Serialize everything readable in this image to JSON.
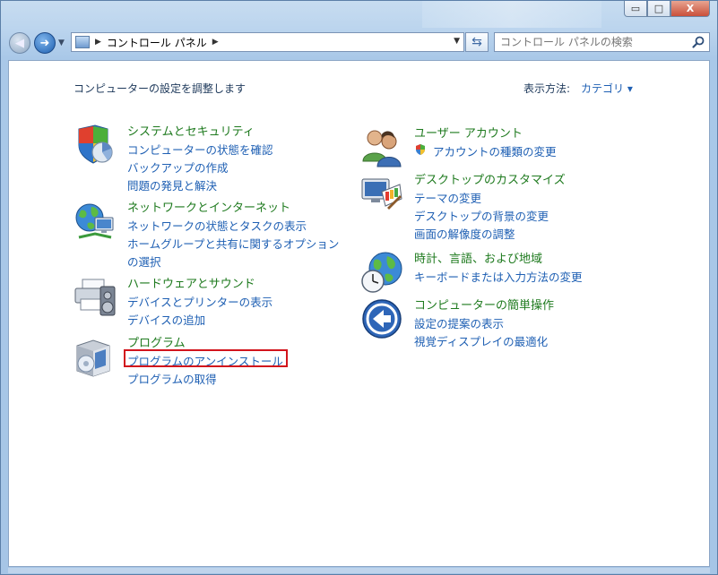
{
  "window": {
    "minimize_glyph": "▭",
    "maximize_glyph": "□",
    "close_glyph": "X"
  },
  "nav": {
    "back_glyph": "◀",
    "forward_glyph": "➜",
    "recent_glyph": "▼",
    "address_path": [
      "コントロール パネル"
    ],
    "address_sep": "▶",
    "address_dropdown": "▼",
    "refresh_glyph": "⇆",
    "search_placeholder": "コントロール パネルの検索"
  },
  "content": {
    "header": "コンピューターの設定を調整します",
    "view_label": "表示方法:",
    "view_value": "カテゴリ ▾"
  },
  "categories_left": [
    {
      "title": "システムとセキュリティ",
      "icon": "shield-chart-icon",
      "links": [
        "コンピューターの状態を確認",
        "バックアップの作成",
        "問題の発見と解決"
      ]
    },
    {
      "title": "ネットワークとインターネット",
      "icon": "network-globe-icon",
      "links": [
        "ネットワークの状態とタスクの表示",
        "ホームグループと共有に関するオプションの選択"
      ]
    },
    {
      "title": "ハードウェアとサウンド",
      "icon": "printer-speaker-icon",
      "links": [
        "デバイスとプリンターの表示",
        "デバイスの追加"
      ]
    },
    {
      "title": "プログラム",
      "icon": "program-box-icon",
      "links": [
        "プログラムのアンインストール",
        "プログラムの取得"
      ]
    }
  ],
  "categories_right": [
    {
      "title": "ユーザー アカウント",
      "icon": "users-icon",
      "links": [
        "アカウントの種類の変更"
      ]
    },
    {
      "title": "デスクトップのカスタマイズ",
      "icon": "monitor-palette-icon",
      "links": [
        "テーマの変更",
        "デスクトップの背景の変更",
        "画面の解像度の調整"
      ]
    },
    {
      "title": "時計、言語、および地域",
      "icon": "clock-globe-icon",
      "links": [
        "キーボードまたは入力方法の変更"
      ]
    },
    {
      "title": "コンピューターの簡単操作",
      "icon": "ease-of-access-icon",
      "links": [
        "設定の提案の表示",
        "視覚ディスプレイの最適化"
      ]
    }
  ],
  "colors": {
    "category_title": "#1e7a1e",
    "link": "#1e5fb3",
    "highlight_border": "#d2141c"
  }
}
